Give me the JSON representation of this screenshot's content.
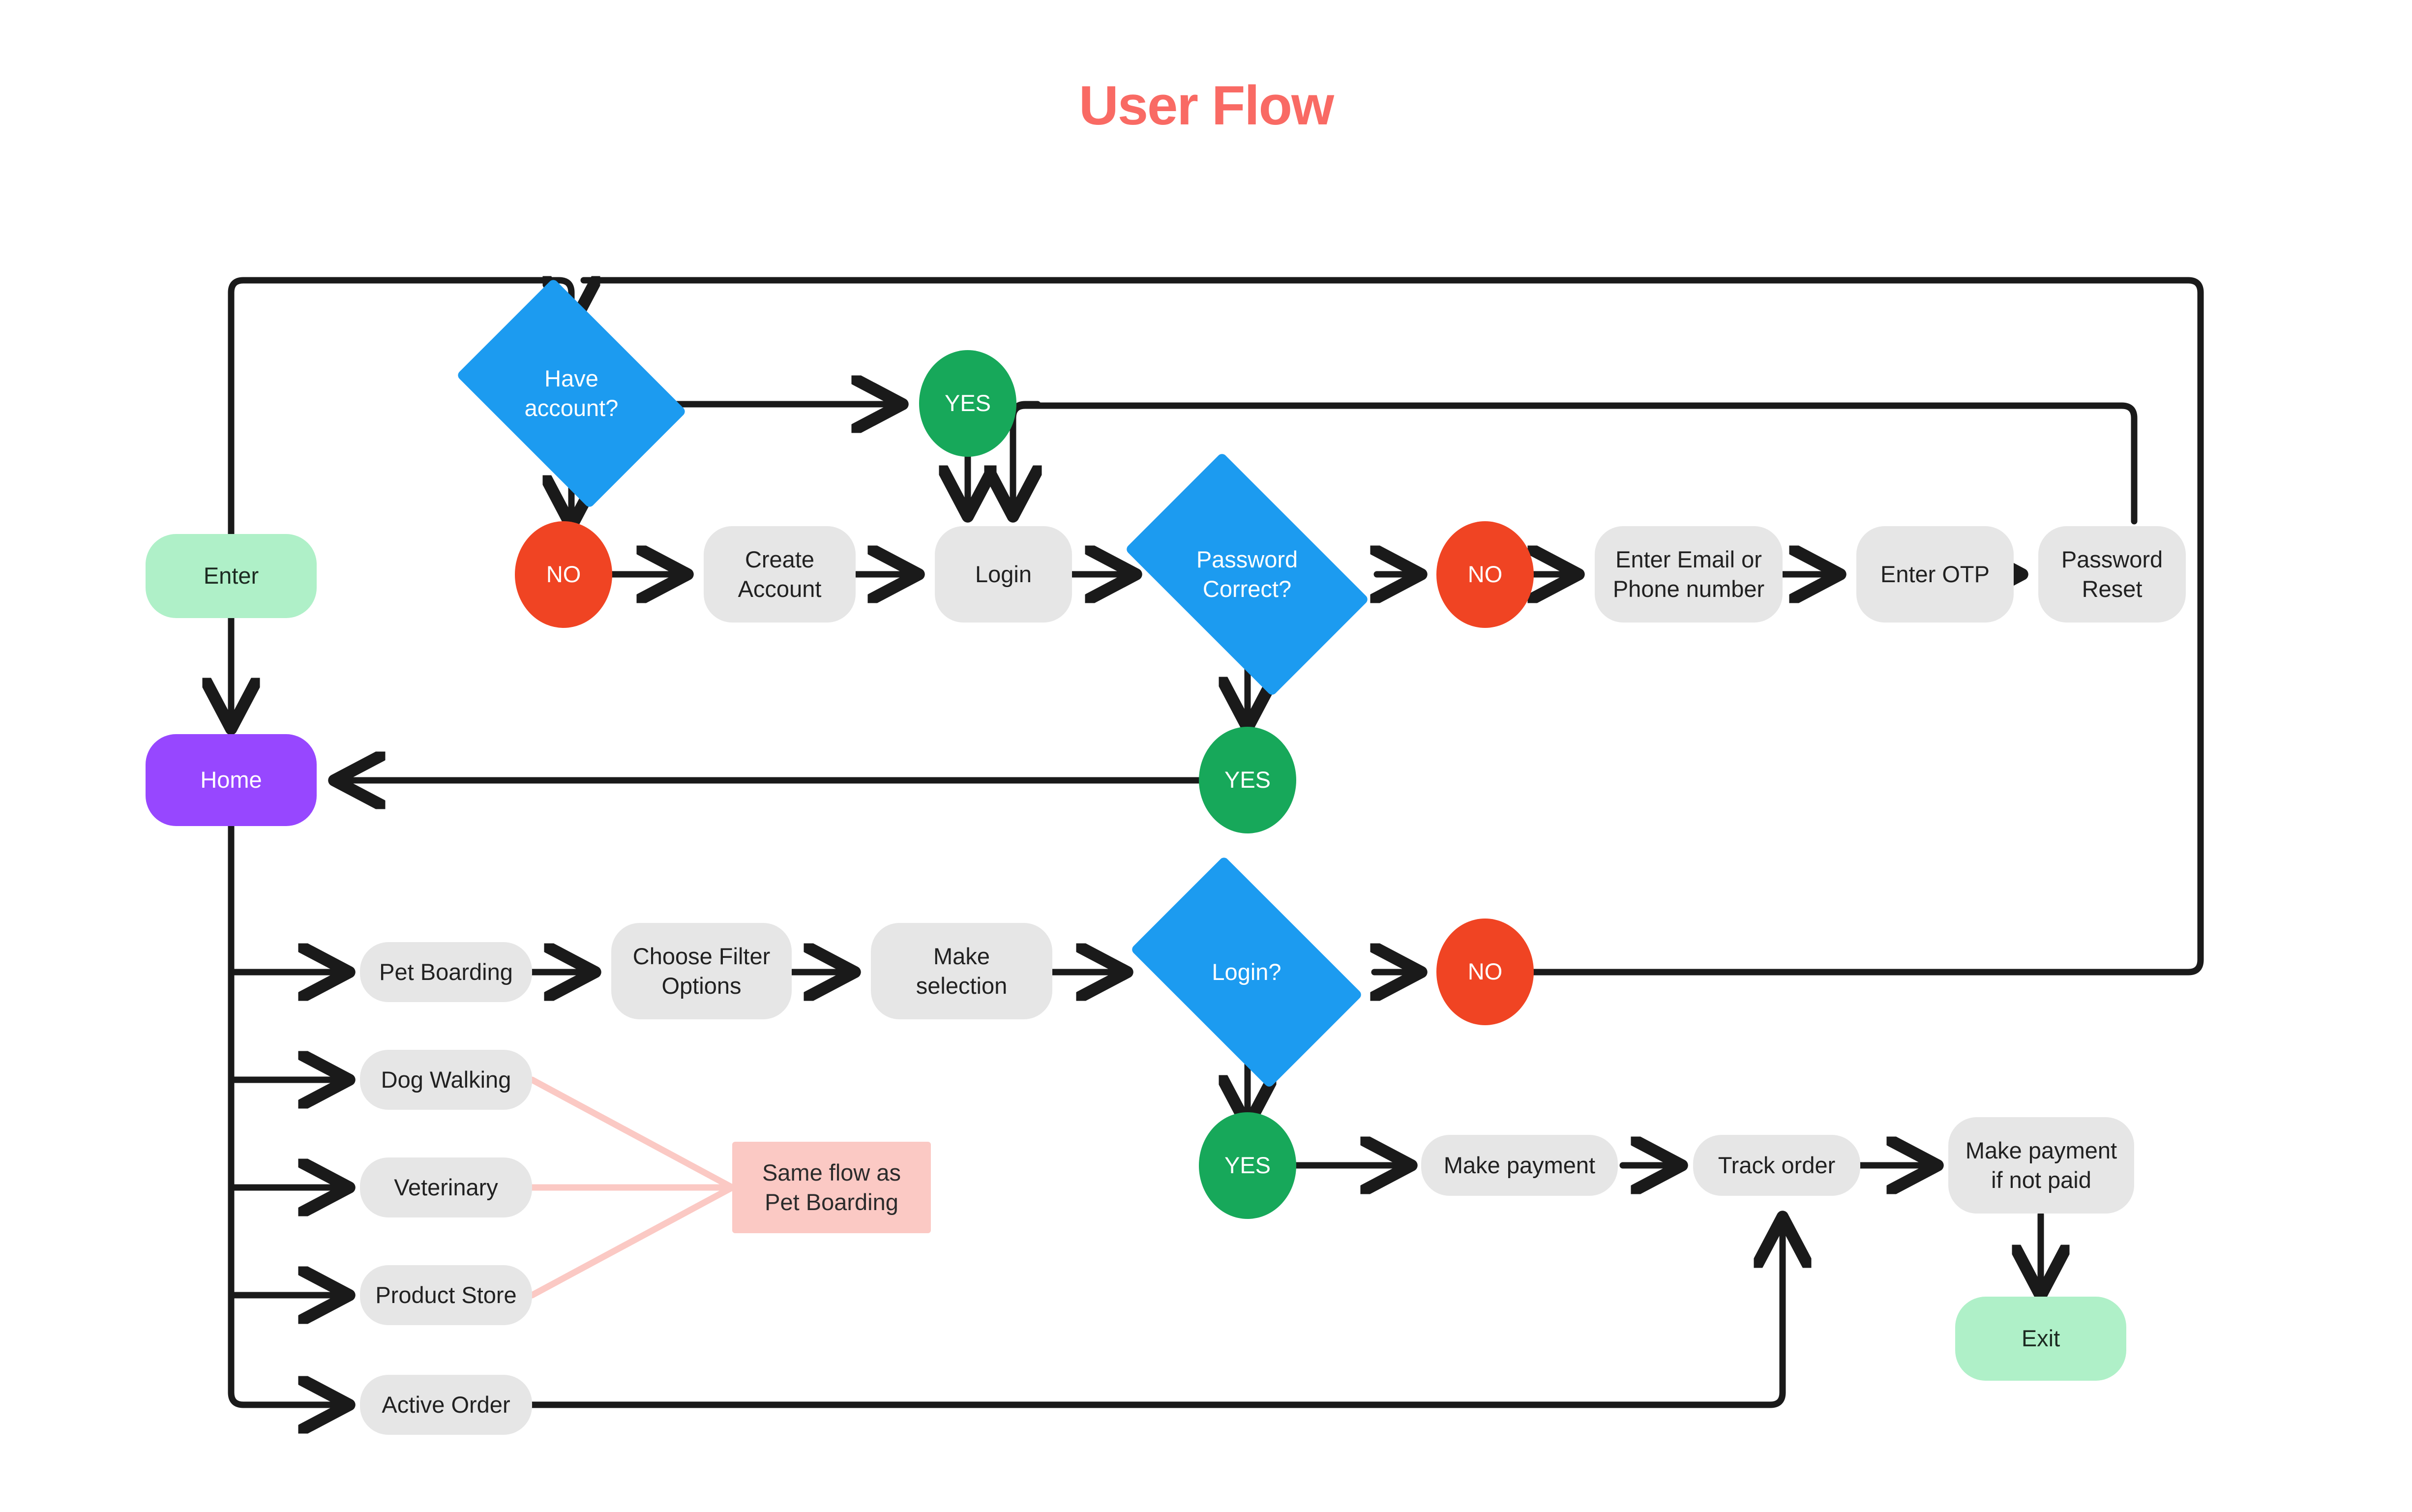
{
  "title": "User Flow",
  "colors": {
    "title": "#F96A64",
    "decision": "#1C9BF0",
    "yes": "#17A85A",
    "no": "#F04423",
    "process": "#E6E6E6",
    "terminal": "#AFF0C8",
    "home": "#9747FF",
    "note": "#FBC9C4",
    "note_line": "#FBC9C4",
    "edge": "#1A1A1A"
  },
  "nodes": {
    "enter": {
      "label": "Enter",
      "type": "terminal"
    },
    "have_account": {
      "label": "Have\naccount?",
      "type": "decision"
    },
    "have_account_no": {
      "label": "NO",
      "type": "no"
    },
    "have_account_yes": {
      "label": "YES",
      "type": "yes"
    },
    "create_account": {
      "label": "Create\nAccount",
      "type": "process"
    },
    "login": {
      "label": "Login",
      "type": "process"
    },
    "password_correct": {
      "label": "Password\nCorrect?",
      "type": "decision"
    },
    "password_no": {
      "label": "NO",
      "type": "no"
    },
    "password_yes": {
      "label": "YES",
      "type": "yes"
    },
    "enter_email_phone": {
      "label": "Enter Email or\nPhone number",
      "type": "process"
    },
    "enter_otp": {
      "label": "Enter OTP",
      "type": "process"
    },
    "password_reset": {
      "label": "Password\nReset",
      "type": "process"
    },
    "home": {
      "label": "Home",
      "type": "home"
    },
    "pet_boarding": {
      "label": "Pet Boarding",
      "type": "process"
    },
    "choose_filter_options": {
      "label": "Choose Filter\nOptions",
      "type": "process"
    },
    "make_selection": {
      "label": "Make\nselection",
      "type": "process"
    },
    "dog_walking": {
      "label": "Dog Walking",
      "type": "process"
    },
    "veterinary": {
      "label": "Veterinary",
      "type": "process"
    },
    "product_store": {
      "label": "Product Store",
      "type": "process"
    },
    "active_order": {
      "label": "Active Order",
      "type": "process"
    },
    "same_flow_note": {
      "label": "Same flow as\nPet Boarding",
      "type": "note"
    },
    "login_decision": {
      "label": "Login?",
      "type": "decision"
    },
    "login_no": {
      "label": "NO",
      "type": "no"
    },
    "login_yes": {
      "label": "YES",
      "type": "yes"
    },
    "make_payment": {
      "label": "Make payment",
      "type": "process"
    },
    "track_order": {
      "label": "Track order",
      "type": "process"
    },
    "make_payment_if_not_paid": {
      "label": "Make payment\nif not paid",
      "type": "process"
    },
    "exit": {
      "label": "Exit",
      "type": "terminal"
    }
  },
  "edges": [
    {
      "from": "enter",
      "to": "have_account"
    },
    {
      "from": "enter",
      "to": "home"
    },
    {
      "from": "have_account",
      "to": "have_account_no"
    },
    {
      "from": "have_account",
      "to": "have_account_yes"
    },
    {
      "from": "have_account_no",
      "to": "create_account"
    },
    {
      "from": "create_account",
      "to": "login"
    },
    {
      "from": "have_account_yes",
      "to": "login"
    },
    {
      "from": "have_account_yes",
      "to": "login_right_branch"
    },
    {
      "from": "login",
      "to": "password_correct"
    },
    {
      "from": "password_correct",
      "to": "password_no"
    },
    {
      "from": "password_correct",
      "to": "password_yes"
    },
    {
      "from": "password_yes",
      "to": "home"
    },
    {
      "from": "password_no",
      "to": "enter_email_phone"
    },
    {
      "from": "enter_email_phone",
      "to": "enter_otp"
    },
    {
      "from": "enter_otp",
      "to": "password_reset"
    },
    {
      "from": "password_reset",
      "to": "login"
    },
    {
      "from": "home",
      "to": "pet_boarding"
    },
    {
      "from": "home",
      "to": "dog_walking"
    },
    {
      "from": "home",
      "to": "veterinary"
    },
    {
      "from": "home",
      "to": "product_store"
    },
    {
      "from": "home",
      "to": "active_order"
    },
    {
      "from": "pet_boarding",
      "to": "choose_filter_options"
    },
    {
      "from": "choose_filter_options",
      "to": "make_selection"
    },
    {
      "from": "make_selection",
      "to": "login_decision"
    },
    {
      "from": "login_decision",
      "to": "login_no"
    },
    {
      "from": "login_decision",
      "to": "login_yes"
    },
    {
      "from": "login_no",
      "to": "have_account"
    },
    {
      "from": "login_yes",
      "to": "make_payment"
    },
    {
      "from": "make_payment",
      "to": "track_order"
    },
    {
      "from": "track_order",
      "to": "make_payment_if_not_paid"
    },
    {
      "from": "active_order",
      "to": "track_order"
    },
    {
      "from": "make_payment_if_not_paid",
      "to": "exit"
    },
    {
      "from": "dog_walking",
      "to": "same_flow_note"
    },
    {
      "from": "veterinary",
      "to": "same_flow_note"
    },
    {
      "from": "product_store",
      "to": "same_flow_note"
    }
  ]
}
